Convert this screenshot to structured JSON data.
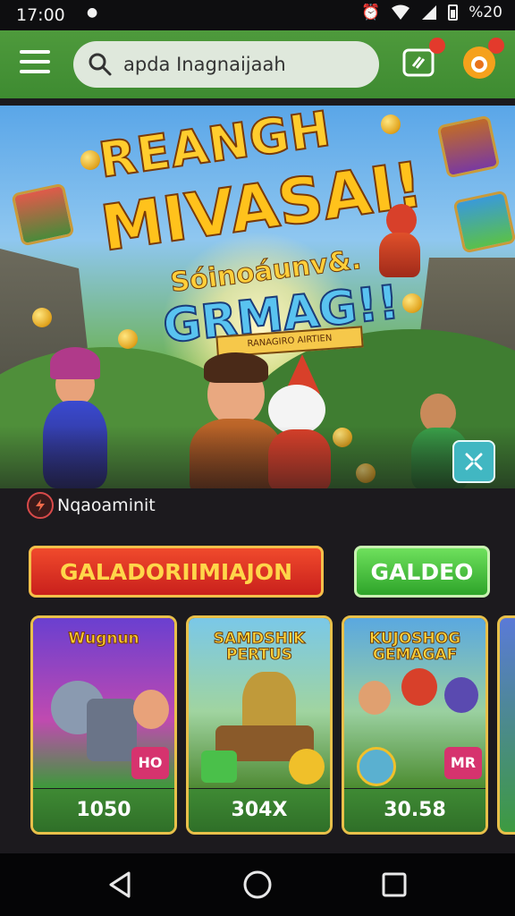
{
  "status_bar": {
    "time": "17:00",
    "battery": "%20",
    "icons": [
      "alarm-icon",
      "wifi-icon",
      "signal-icon",
      "battery-icon"
    ]
  },
  "header": {
    "search_value": "apda Inagnaijaah",
    "search_icon": "search-icon",
    "wallet_badge": "",
    "notification_badge": "",
    "accent_color": "#3e8b31"
  },
  "banner": {
    "line1": "REANGH",
    "line2": "MIVASAI!",
    "line3": "Sóinoáunv&.",
    "line4": "GRMAG!!",
    "tagline": "RANAGIRO AIRTIEN"
  },
  "section": {
    "label": "Nqaoaminit"
  },
  "buttons": {
    "primary": "GALADORIIMIAJON",
    "secondary": "GALDEO"
  },
  "cards": [
    {
      "title": "Wugnun",
      "tag": "HO",
      "price": "1050",
      "art_top": "#6a3fd0",
      "art_bottom": "#3d9a3a",
      "title_color": "#ffcf2e"
    },
    {
      "title": "SAMDSHIK\nPERTUS",
      "tag": "",
      "price": "304X",
      "art_top": "#7ac8e8",
      "art_bottom": "#4f8a34",
      "title_color": "#ffd43a"
    },
    {
      "title": "KUJOSHOG\nGEMAGAF",
      "tag": "MR",
      "price": "30.58",
      "art_top": "#5aa8e0",
      "art_bottom": "#4c8c30",
      "title_color": "#ffd43a"
    }
  ]
}
